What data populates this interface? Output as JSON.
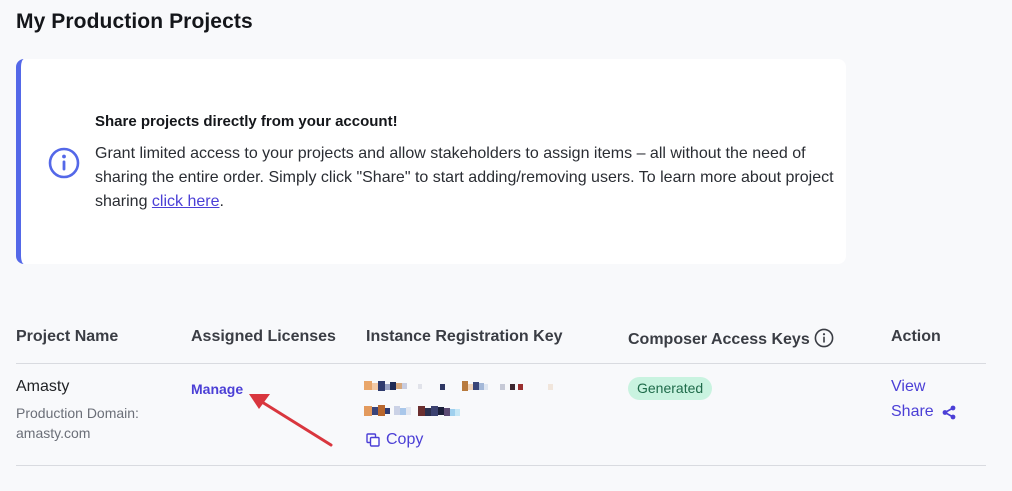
{
  "page": {
    "title": "My Production Projects"
  },
  "notice": {
    "heading": "Share projects directly from your account!",
    "body": "Grant limited access to your projects and allow stakeholders to assign items – all without the need of sharing the entire order. Simply click \"Share\" to start adding/removing users. To learn more about project sharing ",
    "link_label": "click here",
    "trailing": ".",
    "icon": "info-circle-icon"
  },
  "table": {
    "headers": {
      "project_name": "Project Name",
      "assigned_licenses": "Assigned Licenses",
      "instance_key": "Instance Registration Key",
      "composer_keys": "Composer Access Keys",
      "action": "Action"
    },
    "rows": [
      {
        "project_name": "Amasty",
        "domain_line": "Production Domain: amasty.com",
        "manage_label": "Manage",
        "copy_label": "Copy",
        "composer_status": "Generated",
        "view_label": "View",
        "share_label": "Share"
      }
    ]
  },
  "colors": {
    "accent": "#4b3fd6",
    "notice_border": "#5468e8",
    "badge_bg": "#c9f3e0",
    "badge_text": "#1f6b4a",
    "annotation_arrow": "#d9363e"
  }
}
